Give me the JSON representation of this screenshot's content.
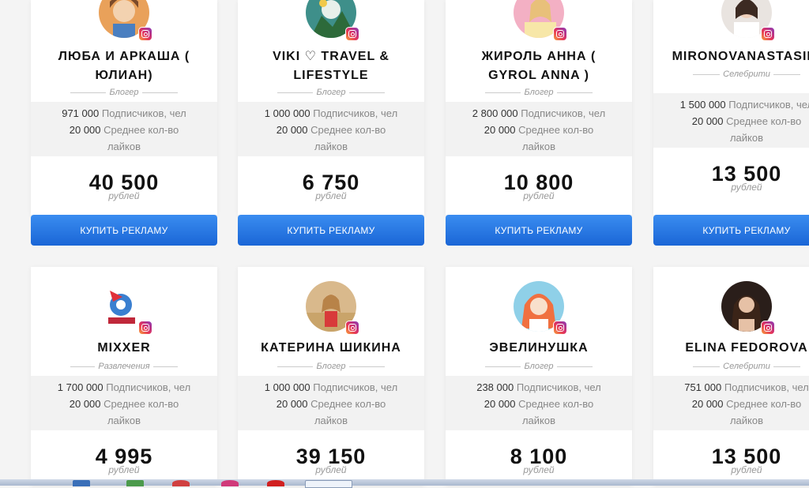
{
  "subscribers_suffix": "Подписчиков, чел",
  "likes_suffix": "Среднее кол-во",
  "likes_suffix2": "лайков",
  "currency": "рублей",
  "buy_label": "КУПИТЬ РЕКЛАМУ",
  "cards": [
    {
      "name_l1": "ЛЮБА И АРКАША (",
      "name_l2": "ЮЛИАН)",
      "category": "Блогер",
      "subscribers": "971 000",
      "likes": "20 000",
      "price": "40 500"
    },
    {
      "name_l1": "VIKI ♡ TRAVEL &",
      "name_l2": "LIFESTYLE",
      "category": "Блогер",
      "subscribers": "1 000 000",
      "likes": "20 000",
      "price": "6 750"
    },
    {
      "name_l1": "ЖИРОЛЬ АННА (",
      "name_l2": "GYROL ANNA )",
      "category": "Блогер",
      "subscribers": "2 800 000",
      "likes": "20 000",
      "price": "10 800"
    },
    {
      "name_l1": "MIRONOVANASTASIIA",
      "name_l2": "",
      "category": "Селебрити",
      "subscribers": "1 500 000",
      "likes": "20 000",
      "price": "13 500"
    },
    {
      "name_l1": "MIXXER",
      "name_l2": "",
      "category": "Развлечения",
      "subscribers": "1 700 000",
      "likes": "20 000",
      "price": "4 995"
    },
    {
      "name_l1": "КАТЕРИНА ШИКИНА",
      "name_l2": "",
      "category": "Блогер",
      "subscribers": "1 000 000",
      "likes": "20 000",
      "price": "39 150"
    },
    {
      "name_l1": "ЭВЕЛИНУШКА",
      "name_l2": "",
      "category": "Блогер",
      "subscribers": "238 000",
      "likes": "20 000",
      "price": "8 100"
    },
    {
      "name_l1": "ELINA FEDOROVA",
      "name_l2": "",
      "category": "Селебрити",
      "subscribers": "751 000",
      "likes": "20 000",
      "price": "13 500"
    }
  ]
}
